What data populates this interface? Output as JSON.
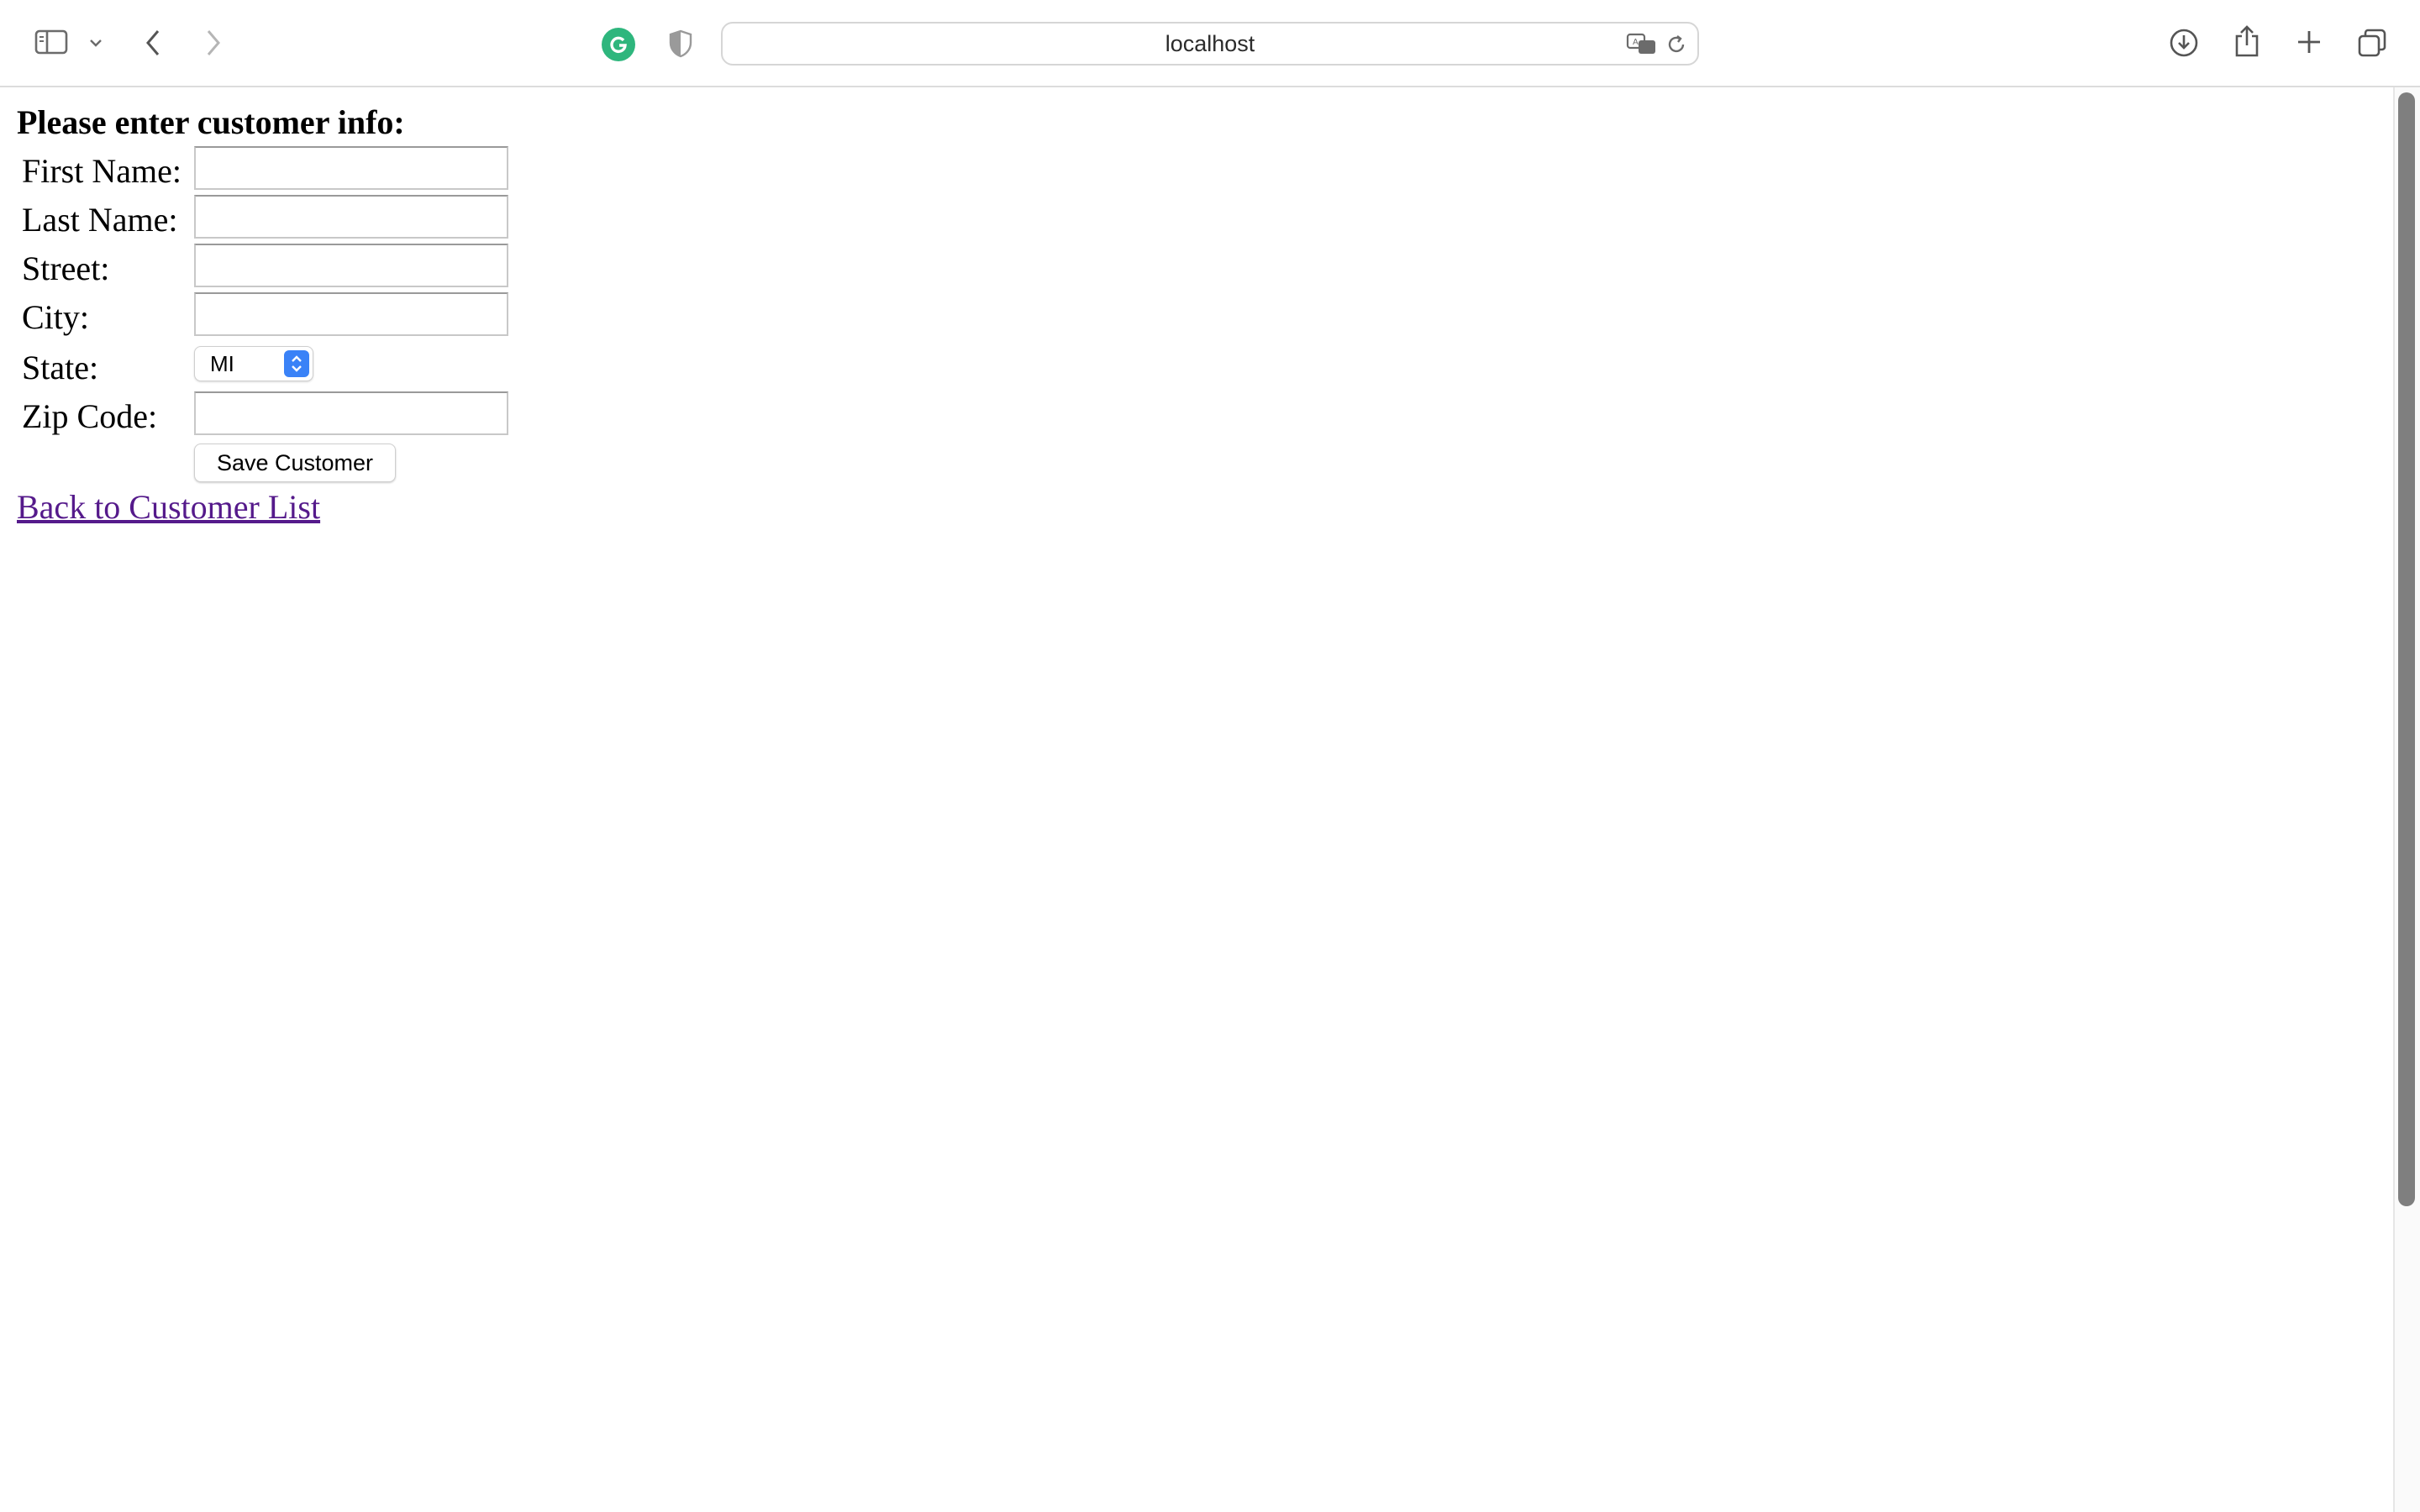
{
  "browser": {
    "address": "localhost",
    "icons": {
      "sidebar": "sidebar-icon",
      "sidebar_menu": "chevron-down-icon",
      "back": "chevron-left-icon",
      "forward": "chevron-right-icon",
      "extension_grammarly": "grammarly-icon",
      "privacy": "shield-icon",
      "translate": "translate-icon",
      "reload": "reload-icon",
      "downloads": "download-icon",
      "share": "share-icon",
      "new_tab": "plus-icon",
      "tab_overview": "tabs-icon"
    },
    "colors": {
      "grammarly": "#2eb67d",
      "select_accent": "#3a82f7",
      "visited_link": "#551a8b"
    }
  },
  "page": {
    "heading": "Please enter customer info:",
    "fields": {
      "first_name": {
        "label": "First Name:",
        "value": ""
      },
      "last_name": {
        "label": "Last Name:",
        "value": ""
      },
      "street": {
        "label": "Street:",
        "value": ""
      },
      "city": {
        "label": "City:",
        "value": ""
      },
      "state": {
        "label": "State:",
        "selected": "MI"
      },
      "zip": {
        "label": "Zip Code:",
        "value": ""
      }
    },
    "save_button": "Save Customer",
    "back_link": "Back to Customer List"
  }
}
